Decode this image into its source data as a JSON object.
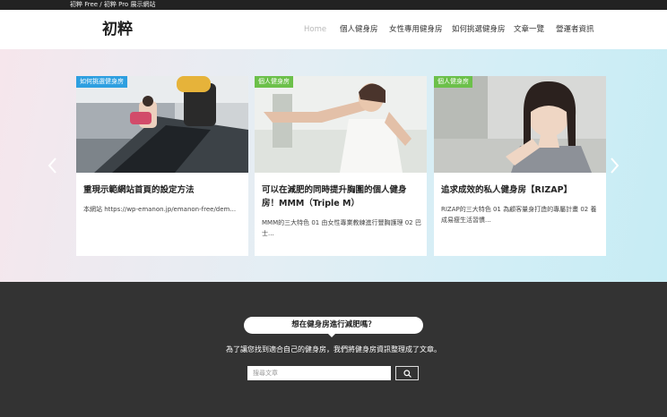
{
  "topbar": {
    "text": "初粹 Free / 初粹 Pro 展示網站"
  },
  "header": {
    "logo": "初粹"
  },
  "nav": {
    "items": [
      {
        "label": "Home",
        "current": true
      },
      {
        "label": "個人健身房"
      },
      {
        "label": "女性專用健身房"
      },
      {
        "label": "如何挑選健身房"
      },
      {
        "label": "文章一覽"
      },
      {
        "label": "營運者資訊"
      }
    ]
  },
  "colors": {
    "badge_blue": "#2e9fe0",
    "badge_green": "#6cc04a",
    "dark_bg": "#333333"
  },
  "slider": {
    "prev_icon": "chevron-left-icon",
    "next_icon": "chevron-right-icon",
    "cards": [
      {
        "badge": "如何挑選健身房",
        "title": "重現示範網站首頁的設定方法",
        "excerpt": "本網站 https://wp-emanon.jp/emanon-free/dem..."
      },
      {
        "badge": "個人健身房",
        "title": "可以在減肥的同時提升胸圍的個人健身房！MMM（Triple M）",
        "excerpt": "MMM的三大特色 01 由女性專業教練進行豐胸護理 02 巴士..."
      },
      {
        "badge": "個人健身房",
        "title": "追求成效的私人健身房【RIZAP】",
        "excerpt": "RIZAP的三大特色 01 為顧客量身打造的專屬計畫 02 養成易瘦生活習慣..."
      }
    ]
  },
  "cta": {
    "heading": "想在健身房進行減肥嗎？",
    "subtext": "為了讓您找到適合自己的健身房，我們將健身房資訊整理成了文章。",
    "search_placeholder": "搜尋文章",
    "search_icon": "search-icon"
  }
}
